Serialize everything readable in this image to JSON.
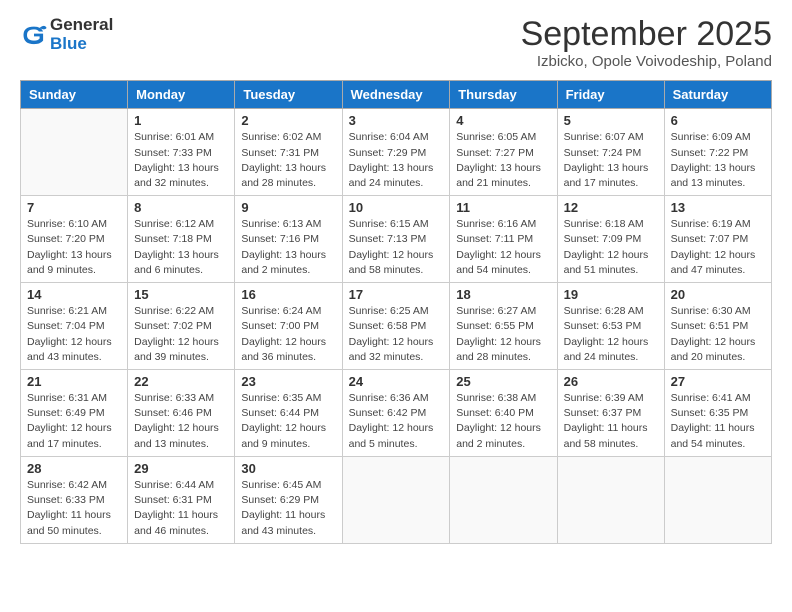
{
  "header": {
    "logo_general": "General",
    "logo_blue": "Blue",
    "month_title": "September 2025",
    "subtitle": "Izbicko, Opole Voivodeship, Poland"
  },
  "weekdays": [
    "Sunday",
    "Monday",
    "Tuesday",
    "Wednesday",
    "Thursday",
    "Friday",
    "Saturday"
  ],
  "weeks": [
    [
      {
        "day": "",
        "info": ""
      },
      {
        "day": "1",
        "info": "Sunrise: 6:01 AM\nSunset: 7:33 PM\nDaylight: 13 hours\nand 32 minutes."
      },
      {
        "day": "2",
        "info": "Sunrise: 6:02 AM\nSunset: 7:31 PM\nDaylight: 13 hours\nand 28 minutes."
      },
      {
        "day": "3",
        "info": "Sunrise: 6:04 AM\nSunset: 7:29 PM\nDaylight: 13 hours\nand 24 minutes."
      },
      {
        "day": "4",
        "info": "Sunrise: 6:05 AM\nSunset: 7:27 PM\nDaylight: 13 hours\nand 21 minutes."
      },
      {
        "day": "5",
        "info": "Sunrise: 6:07 AM\nSunset: 7:24 PM\nDaylight: 13 hours\nand 17 minutes."
      },
      {
        "day": "6",
        "info": "Sunrise: 6:09 AM\nSunset: 7:22 PM\nDaylight: 13 hours\nand 13 minutes."
      }
    ],
    [
      {
        "day": "7",
        "info": "Sunrise: 6:10 AM\nSunset: 7:20 PM\nDaylight: 13 hours\nand 9 minutes."
      },
      {
        "day": "8",
        "info": "Sunrise: 6:12 AM\nSunset: 7:18 PM\nDaylight: 13 hours\nand 6 minutes."
      },
      {
        "day": "9",
        "info": "Sunrise: 6:13 AM\nSunset: 7:16 PM\nDaylight: 13 hours\nand 2 minutes."
      },
      {
        "day": "10",
        "info": "Sunrise: 6:15 AM\nSunset: 7:13 PM\nDaylight: 12 hours\nand 58 minutes."
      },
      {
        "day": "11",
        "info": "Sunrise: 6:16 AM\nSunset: 7:11 PM\nDaylight: 12 hours\nand 54 minutes."
      },
      {
        "day": "12",
        "info": "Sunrise: 6:18 AM\nSunset: 7:09 PM\nDaylight: 12 hours\nand 51 minutes."
      },
      {
        "day": "13",
        "info": "Sunrise: 6:19 AM\nSunset: 7:07 PM\nDaylight: 12 hours\nand 47 minutes."
      }
    ],
    [
      {
        "day": "14",
        "info": "Sunrise: 6:21 AM\nSunset: 7:04 PM\nDaylight: 12 hours\nand 43 minutes."
      },
      {
        "day": "15",
        "info": "Sunrise: 6:22 AM\nSunset: 7:02 PM\nDaylight: 12 hours\nand 39 minutes."
      },
      {
        "day": "16",
        "info": "Sunrise: 6:24 AM\nSunset: 7:00 PM\nDaylight: 12 hours\nand 36 minutes."
      },
      {
        "day": "17",
        "info": "Sunrise: 6:25 AM\nSunset: 6:58 PM\nDaylight: 12 hours\nand 32 minutes."
      },
      {
        "day": "18",
        "info": "Sunrise: 6:27 AM\nSunset: 6:55 PM\nDaylight: 12 hours\nand 28 minutes."
      },
      {
        "day": "19",
        "info": "Sunrise: 6:28 AM\nSunset: 6:53 PM\nDaylight: 12 hours\nand 24 minutes."
      },
      {
        "day": "20",
        "info": "Sunrise: 6:30 AM\nSunset: 6:51 PM\nDaylight: 12 hours\nand 20 minutes."
      }
    ],
    [
      {
        "day": "21",
        "info": "Sunrise: 6:31 AM\nSunset: 6:49 PM\nDaylight: 12 hours\nand 17 minutes."
      },
      {
        "day": "22",
        "info": "Sunrise: 6:33 AM\nSunset: 6:46 PM\nDaylight: 12 hours\nand 13 minutes."
      },
      {
        "day": "23",
        "info": "Sunrise: 6:35 AM\nSunset: 6:44 PM\nDaylight: 12 hours\nand 9 minutes."
      },
      {
        "day": "24",
        "info": "Sunrise: 6:36 AM\nSunset: 6:42 PM\nDaylight: 12 hours\nand 5 minutes."
      },
      {
        "day": "25",
        "info": "Sunrise: 6:38 AM\nSunset: 6:40 PM\nDaylight: 12 hours\nand 2 minutes."
      },
      {
        "day": "26",
        "info": "Sunrise: 6:39 AM\nSunset: 6:37 PM\nDaylight: 11 hours\nand 58 minutes."
      },
      {
        "day": "27",
        "info": "Sunrise: 6:41 AM\nSunset: 6:35 PM\nDaylight: 11 hours\nand 54 minutes."
      }
    ],
    [
      {
        "day": "28",
        "info": "Sunrise: 6:42 AM\nSunset: 6:33 PM\nDaylight: 11 hours\nand 50 minutes."
      },
      {
        "day": "29",
        "info": "Sunrise: 6:44 AM\nSunset: 6:31 PM\nDaylight: 11 hours\nand 46 minutes."
      },
      {
        "day": "30",
        "info": "Sunrise: 6:45 AM\nSunset: 6:29 PM\nDaylight: 11 hours\nand 43 minutes."
      },
      {
        "day": "",
        "info": ""
      },
      {
        "day": "",
        "info": ""
      },
      {
        "day": "",
        "info": ""
      },
      {
        "day": "",
        "info": ""
      }
    ]
  ]
}
